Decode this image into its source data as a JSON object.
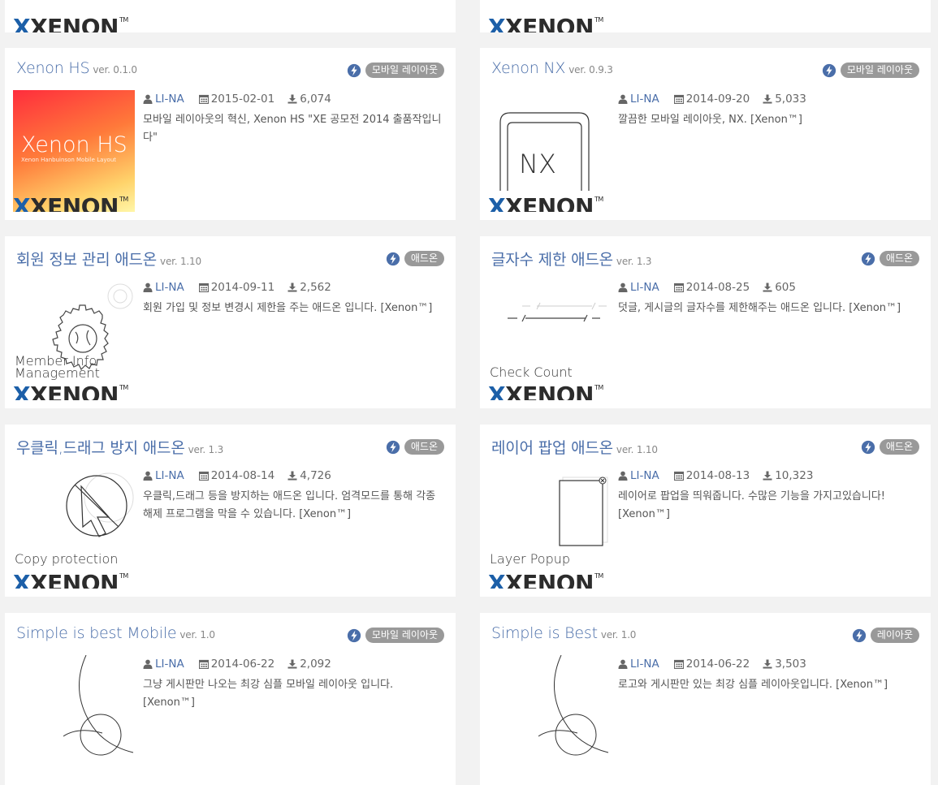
{
  "brand": {
    "xenon": "XENON",
    "tm": "TM"
  },
  "cards": [
    {
      "title": "Xenon HS",
      "version": "ver. 0.1.0",
      "category": "모바일 레이아웃",
      "author": "LI-NA",
      "date": "2015-02-01",
      "downloads": "6,074",
      "description": "모바일 레이아웃의 혁신, Xenon HS \"XE 공모전 2014 출품작입니다\"",
      "thumb_title": "Xenon HS",
      "thumb_subtitle": "Xenon Hanbuinson Mobile Layout"
    },
    {
      "title": "Xenon NX",
      "version": "ver. 0.9.3",
      "category": "모바일 레이아웃",
      "author": "LI-NA",
      "date": "2014-09-20",
      "downloads": "5,033",
      "description": "깔끔한 모바일 레이아웃, NX. [Xenon™]",
      "thumb_title": "NX"
    },
    {
      "title": "회원 정보 관리 애드온",
      "version": "ver. 1.10",
      "category": "애드온",
      "author": "LI-NA",
      "date": "2014-09-11",
      "downloads": "2,562",
      "description": "회원 가입 및 정보 변경시 제한을 주는 애드온 입니다. [Xenon™]",
      "thumb_label_1": "Member Info",
      "thumb_label_2": "Management"
    },
    {
      "title": "글자수 제한 애드온",
      "version": "ver. 1.3",
      "category": "애드온",
      "author": "LI-NA",
      "date": "2014-08-25",
      "downloads": "605",
      "description": "덧글, 게시글의 글자수를 제한해주는 애드온 입니다. [Xenon™]",
      "thumb_label_1": "Check Count"
    },
    {
      "title": "우클릭,드래그 방지 애드온",
      "version": "ver. 1.3",
      "category": "애드온",
      "author": "LI-NA",
      "date": "2014-08-14",
      "downloads": "4,726",
      "description": "우클릭,드래그 등을 방지하는 애드온 입니다. 엄격모드를 통해 각종 해제 프로그램을 막을 수 있습니다. [Xenon™]",
      "thumb_label_1": "Copy protection"
    },
    {
      "title": "레이어 팝업 애드온",
      "version": "ver. 1.10",
      "category": "애드온",
      "author": "LI-NA",
      "date": "2014-08-13",
      "downloads": "10,323",
      "description": "레이어로 팝업을 띄워줍니다. 수많은 기능을 가지고있습니다! [Xenon™]",
      "thumb_label_1": "Layer Popup"
    },
    {
      "title": "Simple is best Mobile",
      "version": "ver. 1.0",
      "category": "모바일 레이아웃",
      "author": "LI-NA",
      "date": "2014-06-22",
      "downloads": "2,092",
      "description": "그냥 게시판만 나오는 최강 심플 모바일 레이아웃 입니다. [Xenon™]"
    },
    {
      "title": "Simple is Best",
      "version": "ver. 1.0",
      "category": "레이아웃",
      "author": "LI-NA",
      "date": "2014-06-22",
      "downloads": "3,503",
      "description": "로고와 게시판만 있는 최강 심플 레이아웃입니다. [Xenon™]"
    }
  ]
}
